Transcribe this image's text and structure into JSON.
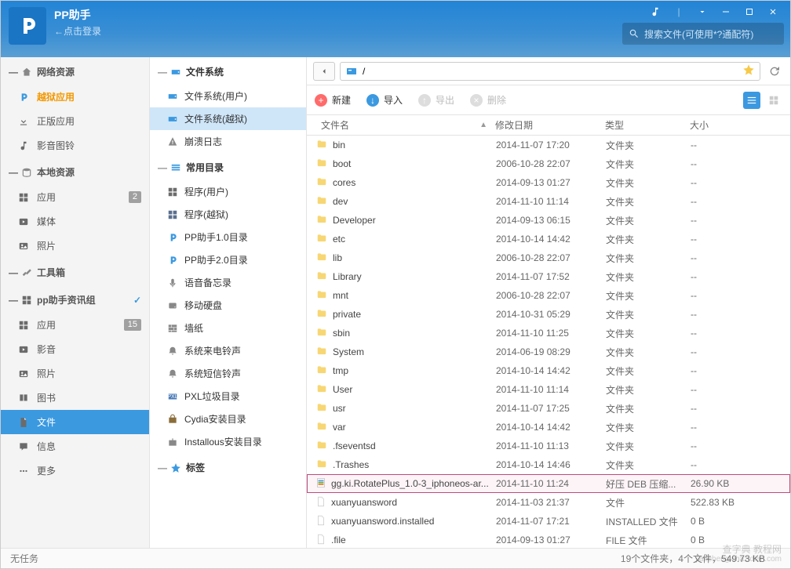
{
  "app": {
    "title": "PP助手",
    "login_hint": "←点击登录",
    "search_placeholder": "搜索文件(可使用*?通配符)"
  },
  "sidebar": {
    "sections": [
      {
        "name": "网络资源",
        "items": [
          {
            "icon": "pp",
            "label": "越狱应用",
            "active": true
          },
          {
            "icon": "download",
            "label": "正版应用"
          },
          {
            "icon": "music",
            "label": "影音图铃"
          }
        ]
      },
      {
        "name": "本地资源",
        "items": [
          {
            "icon": "apps",
            "label": "应用",
            "badge": "2"
          },
          {
            "icon": "media",
            "label": "媒体"
          },
          {
            "icon": "photo",
            "label": "照片"
          }
        ]
      },
      {
        "name": "工具箱",
        "items": []
      },
      {
        "name": "pp助手资讯组",
        "check": true,
        "items": [
          {
            "icon": "apps",
            "label": "应用",
            "badge": "15"
          },
          {
            "icon": "media",
            "label": "影音"
          },
          {
            "icon": "photo",
            "label": "照片"
          },
          {
            "icon": "book",
            "label": "图书"
          },
          {
            "icon": "file",
            "label": "文件",
            "file_active": true
          },
          {
            "icon": "info",
            "label": "信息"
          },
          {
            "icon": "more",
            "label": "更多"
          }
        ]
      }
    ]
  },
  "sidebar2": {
    "groups": [
      {
        "name": "文件系统",
        "items": [
          {
            "icon": "disk",
            "label": "文件系统(用户)"
          },
          {
            "icon": "disk",
            "label": "文件系统(越狱)",
            "selected": true
          },
          {
            "icon": "crash",
            "label": "崩溃日志"
          }
        ]
      },
      {
        "name": "常用目录",
        "items": [
          {
            "icon": "apps",
            "label": "程序(用户)"
          },
          {
            "icon": "apps2",
            "label": "程序(越狱)"
          },
          {
            "icon": "pp",
            "label": "PP助手1.0目录"
          },
          {
            "icon": "pp",
            "label": "PP助手2.0目录"
          },
          {
            "icon": "voice",
            "label": "语音备忘录"
          },
          {
            "icon": "hdd",
            "label": "移动硬盘"
          },
          {
            "icon": "wall",
            "label": "墙纸"
          },
          {
            "icon": "ring",
            "label": "系统来电铃声"
          },
          {
            "icon": "ring",
            "label": "系统短信铃声"
          },
          {
            "icon": "pxl",
            "label": "PXL垃圾目录"
          },
          {
            "icon": "cydia",
            "label": "Cydia安装目录"
          },
          {
            "icon": "inst",
            "label": "Installous安装目录"
          }
        ]
      },
      {
        "name": "标签",
        "items": []
      }
    ]
  },
  "pathbar": {
    "path": "/"
  },
  "toolbar": {
    "new": "新建",
    "import": "导入",
    "export": "导出",
    "delete": "删除"
  },
  "columns": {
    "name": "文件名",
    "date": "修改日期",
    "type": "类型",
    "size": "大小"
  },
  "files": [
    {
      "kind": "folder",
      "name": "bin",
      "date": "2014-11-07 17:20",
      "type": "文件夹",
      "size": "--"
    },
    {
      "kind": "folder",
      "name": "boot",
      "date": "2006-10-28 22:07",
      "type": "文件夹",
      "size": "--"
    },
    {
      "kind": "folder",
      "name": "cores",
      "date": "2014-09-13 01:27",
      "type": "文件夹",
      "size": "--"
    },
    {
      "kind": "folder",
      "name": "dev",
      "date": "2014-11-10 11:14",
      "type": "文件夹",
      "size": "--"
    },
    {
      "kind": "folder",
      "name": "Developer",
      "date": "2014-09-13 06:15",
      "type": "文件夹",
      "size": "--"
    },
    {
      "kind": "folder",
      "name": "etc",
      "date": "2014-10-14 14:42",
      "type": "文件夹",
      "size": "--"
    },
    {
      "kind": "folder",
      "name": "lib",
      "date": "2006-10-28 22:07",
      "type": "文件夹",
      "size": "--"
    },
    {
      "kind": "folder",
      "name": "Library",
      "date": "2014-11-07 17:52",
      "type": "文件夹",
      "size": "--"
    },
    {
      "kind": "folder",
      "name": "mnt",
      "date": "2006-10-28 22:07",
      "type": "文件夹",
      "size": "--"
    },
    {
      "kind": "folder",
      "name": "private",
      "date": "2014-10-31 05:29",
      "type": "文件夹",
      "size": "--"
    },
    {
      "kind": "folder",
      "name": "sbin",
      "date": "2014-11-10 11:25",
      "type": "文件夹",
      "size": "--"
    },
    {
      "kind": "folder",
      "name": "System",
      "date": "2014-06-19 08:29",
      "type": "文件夹",
      "size": "--"
    },
    {
      "kind": "folder",
      "name": "tmp",
      "date": "2014-10-14 14:42",
      "type": "文件夹",
      "size": "--"
    },
    {
      "kind": "folder",
      "name": "User",
      "date": "2014-11-10 11:14",
      "type": "文件夹",
      "size": "--"
    },
    {
      "kind": "folder",
      "name": "usr",
      "date": "2014-11-07 17:25",
      "type": "文件夹",
      "size": "--"
    },
    {
      "kind": "folder",
      "name": "var",
      "date": "2014-10-14 14:42",
      "type": "文件夹",
      "size": "--"
    },
    {
      "kind": "folder",
      "name": ".fseventsd",
      "date": "2014-11-10 11:13",
      "type": "文件夹",
      "size": "--"
    },
    {
      "kind": "folder",
      "name": ".Trashes",
      "date": "2014-10-14 14:46",
      "type": "文件夹",
      "size": "--"
    },
    {
      "kind": "deb",
      "name": "gg.ki.RotatePlus_1.0-3_iphoneos-ar...",
      "date": "2014-11-10 11:24",
      "type": "好压 DEB 压缩...",
      "size": "26.90 KB",
      "highlighted": true
    },
    {
      "kind": "file",
      "name": "xuanyuansword",
      "date": "2014-11-03 21:37",
      "type": "文件",
      "size": "522.83 KB"
    },
    {
      "kind": "file",
      "name": "xuanyuansword.installed",
      "date": "2014-11-07 17:21",
      "type": "INSTALLED 文件",
      "size": "0 B"
    },
    {
      "kind": "file",
      "name": ".file",
      "date": "2014-09-13 01:27",
      "type": "FILE 文件",
      "size": "0 B"
    }
  ],
  "statusbar": {
    "left": "无任务",
    "right": "19个文件夹，4个文件，549.73 KB"
  },
  "watermark": {
    "line1": "查字典 教程网",
    "line2": "jiaocheng.chazidian.com"
  }
}
